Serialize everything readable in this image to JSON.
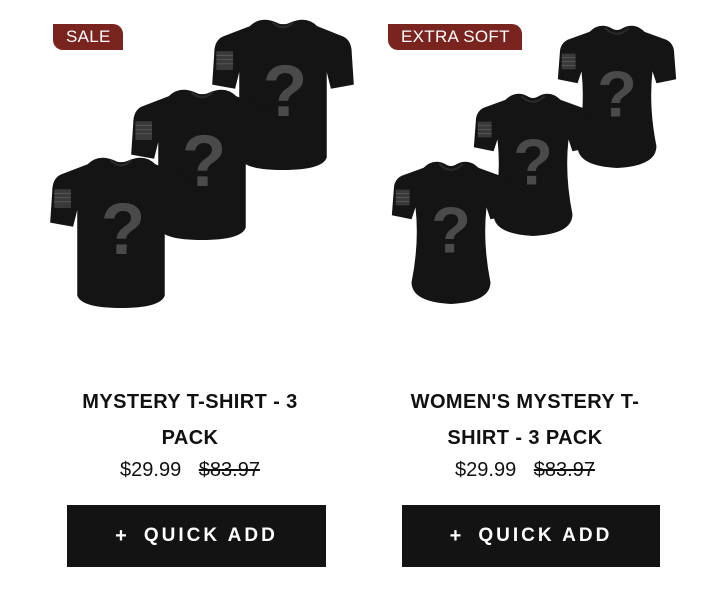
{
  "products": [
    {
      "badge": "SALE",
      "title_line1": "MYSTERY T-SHIRT - 3",
      "title_line2": "PACK",
      "sale_price": "$29.99",
      "original_price": "$83.97",
      "quick_add_plus": "+",
      "quick_add_label": "QUICK ADD"
    },
    {
      "badge": "EXTRA SOFT",
      "title_line1": "WOMEN'S MYSTERY T-",
      "title_line2": "SHIRT - 3 PACK",
      "sale_price": "$29.99",
      "original_price": "$83.97",
      "quick_add_plus": "+",
      "quick_add_label": "QUICK ADD"
    }
  ],
  "colors": {
    "badge_background": "#7a2420",
    "button_background": "#131313",
    "shirt": "#141414",
    "question_mark": "#4a4a4a"
  }
}
